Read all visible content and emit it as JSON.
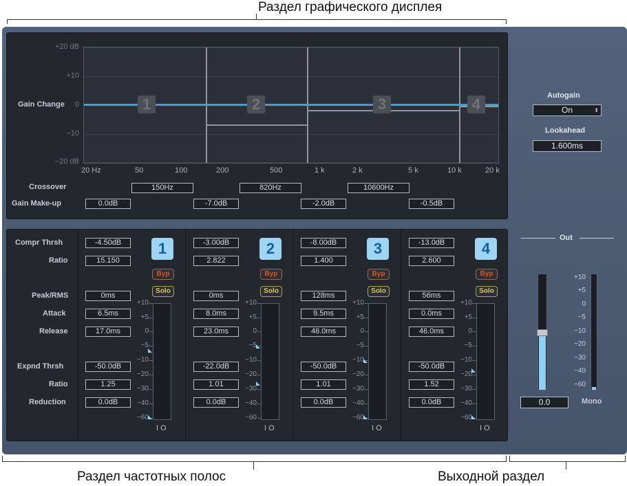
{
  "callouts": {
    "graphic": "Раздел графического дисплея",
    "bands": "Раздел частотных полос",
    "output": "Выходной раздел"
  },
  "graph": {
    "y_labels": [
      "+20 dB",
      "+10",
      "0",
      "−10",
      "−20 dB"
    ],
    "x_labels": [
      "20 Hz",
      "50",
      "100",
      "200",
      "500",
      "1 k",
      "2 k",
      "5 k",
      "10 k",
      "20 k"
    ],
    "gain_change_label": "Gain Change",
    "band_numbers": [
      "1",
      "2",
      "3",
      "4"
    ],
    "crossover_label": "Crossover",
    "crossover_values": [
      "150Hz",
      "820Hz",
      "10600Hz"
    ],
    "gain_makeup_label": "Gain Make-up",
    "gain_makeup_values": [
      "0.0dB",
      "-7.0dB",
      "-2.0dB",
      "-0.5dB"
    ]
  },
  "autogain": {
    "label": "Autogain",
    "value": "On"
  },
  "lookahead": {
    "label": "Lookahead",
    "value": "1.600ms"
  },
  "row_labels": [
    "Compr Thrsh",
    "Ratio",
    "Peak/RMS",
    "Attack",
    "Release",
    "Expnd Thrsh",
    "Ratio",
    "Reduction"
  ],
  "bands": [
    {
      "number": "1",
      "compr_thrsh": "-4.50dB",
      "ratio": "15.150",
      "peak_rms": "0ms",
      "attack": "6.5ms",
      "release": "17.0ms",
      "expnd_thrsh": "-50.0dB",
      "expnd_ratio": "1.25",
      "reduction": "0.0dB",
      "byp": "Byp",
      "solo": "Solo",
      "thrsh_level_db": -4.5,
      "expnd_level_db": -50
    },
    {
      "number": "2",
      "compr_thrsh": "-3.00dB",
      "ratio": "2.822",
      "peak_rms": "0ms",
      "attack": "8.0ms",
      "release": "23.0ms",
      "expnd_thrsh": "-22.0dB",
      "expnd_ratio": "1.01",
      "reduction": "0.0dB",
      "byp": "Byp",
      "solo": "Solo",
      "thrsh_level_db": -3,
      "expnd_level_db": -22
    },
    {
      "number": "3",
      "compr_thrsh": "-8.00dB",
      "ratio": "1.400",
      "peak_rms": "128ms",
      "attack": "9.5ms",
      "release": "46.0ms",
      "expnd_thrsh": "-50.0dB",
      "expnd_ratio": "1.01",
      "reduction": "0.0dB",
      "byp": "Byp",
      "solo": "Solo",
      "thrsh_level_db": -8,
      "expnd_level_db": -50
    },
    {
      "number": "4",
      "compr_thrsh": "-13.0dB",
      "ratio": "2.600",
      "peak_rms": "56ms",
      "attack": "0.0ms",
      "release": "46.0ms",
      "expnd_thrsh": "-50.0dB",
      "expnd_ratio": "1.52",
      "reduction": "0.0dB",
      "byp": "Byp",
      "solo": "Solo",
      "thrsh_level_db": -13,
      "expnd_level_db": -50
    }
  ],
  "meter_scale": [
    "+10",
    "+5",
    "0",
    "−5",
    "−10",
    "−20",
    "−30",
    "−40",
    "−60"
  ],
  "io_label": "I O",
  "output": {
    "title": "Out",
    "value": "0.0",
    "mono_label": "Mono",
    "scale": [
      "+10",
      "+5",
      "0",
      "−5",
      "−10",
      "−20",
      "−30",
      "−40",
      "−60"
    ],
    "fader_level_db": 0
  },
  "colors": {
    "accent": "#9fd4f3",
    "curve": "#3a9fe0",
    "byp": "#e0562a",
    "solo": "#e0c84a"
  }
}
